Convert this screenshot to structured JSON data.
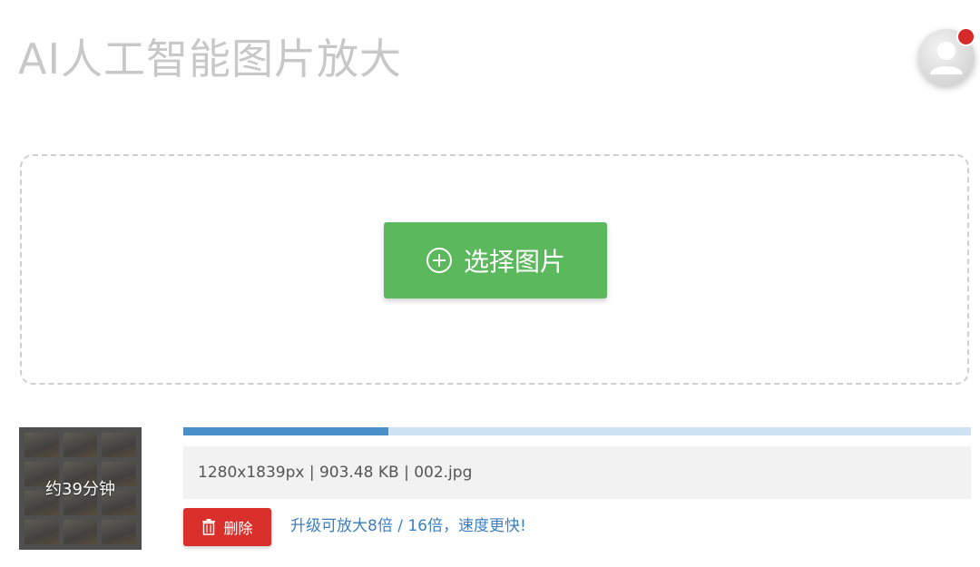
{
  "header": {
    "title": "AI人工智能图片放大",
    "avatar_icon": "user-avatar-icon",
    "notification_color": "#d62a2a"
  },
  "upload": {
    "select_label": "选择图片",
    "select_icon": "plus-circle-icon",
    "button_color": "#5cb85c"
  },
  "file": {
    "eta_label": "约39分钟",
    "progress": 0.26,
    "info": "1280x1839px | 903.48 KB | 002.jpg",
    "delete_label": "删除",
    "delete_icon": "trash-icon",
    "delete_color": "#d9302b",
    "upgrade_text": "升级可放大8倍 / 16倍，速度更快!"
  }
}
